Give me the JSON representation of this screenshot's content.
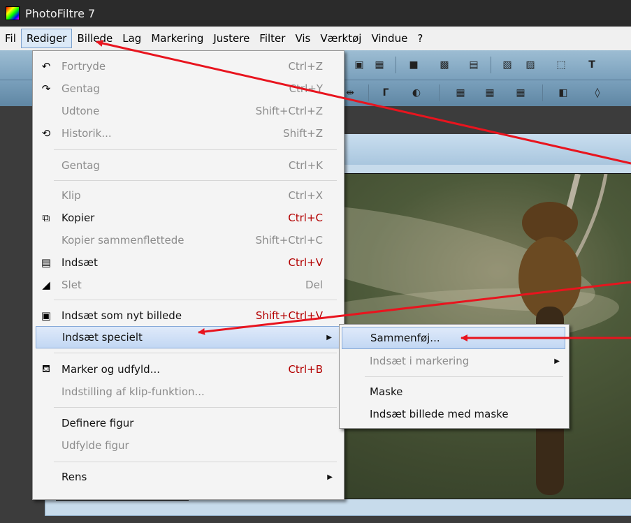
{
  "window": {
    "title": "PhotoFiltre 7"
  },
  "menubar": {
    "items": [
      {
        "label": "Fil"
      },
      {
        "label": "Rediger"
      },
      {
        "label": "Billede"
      },
      {
        "label": "Lag"
      },
      {
        "label": "Markering"
      },
      {
        "label": "Justere"
      },
      {
        "label": "Filter"
      },
      {
        "label": "Vis"
      },
      {
        "label": "Værktøj"
      },
      {
        "label": "Vindue"
      },
      {
        "label": "?"
      }
    ],
    "active": "Rediger"
  },
  "edit_menu": {
    "items": [
      {
        "label": "Fortryde",
        "shortcut": "Ctrl+Z",
        "icon": "undo-icon",
        "enabled": false
      },
      {
        "label": "Gentag",
        "shortcut": "Ctrl+Y",
        "icon": "redo-icon",
        "enabled": false
      },
      {
        "label": "Udtone",
        "shortcut": "Shift+Ctrl+Z",
        "icon": "",
        "enabled": false
      },
      {
        "label": "Historik...",
        "shortcut": "Shift+Z",
        "icon": "history-icon",
        "enabled": false
      },
      {
        "label": "Gentag",
        "shortcut": "Ctrl+K",
        "icon": "",
        "enabled": false
      },
      {
        "label": "Klip",
        "shortcut": "Ctrl+X",
        "icon": "",
        "enabled": false
      },
      {
        "label": "Kopier",
        "shortcut": "Ctrl+C",
        "icon": "copy-icon",
        "enabled": true
      },
      {
        "label": "Kopier sammenflettede",
        "shortcut": "Shift+Ctrl+C",
        "icon": "",
        "enabled": false
      },
      {
        "label": "Indsæt",
        "shortcut": "Ctrl+V",
        "icon": "paste-icon",
        "enabled": true
      },
      {
        "label": "Slet",
        "shortcut": "Del",
        "icon": "eraser-icon",
        "enabled": false
      },
      {
        "label": "Indsæt som nyt billede",
        "shortcut": "Shift+Ctrl+V",
        "icon": "paste-new-image-icon",
        "enabled": true
      },
      {
        "label": "Indsæt specielt",
        "shortcut": "",
        "icon": "",
        "enabled": true,
        "highlighted": true,
        "submenu": true
      },
      {
        "label": "Marker og udfyld...",
        "shortcut": "Ctrl+B",
        "icon": "fill-bucket-icon",
        "enabled": true
      },
      {
        "label": "Indstilling af klip-funktion...",
        "shortcut": "",
        "icon": "",
        "enabled": false
      },
      {
        "label": "Definere figur",
        "shortcut": "",
        "icon": "",
        "enabled": true
      },
      {
        "label": "Udfylde figur",
        "shortcut": "",
        "icon": "",
        "enabled": false
      },
      {
        "label": "Rens",
        "shortcut": "",
        "icon": "",
        "enabled": true,
        "submenu": true
      }
    ]
  },
  "paste_special_submenu": {
    "items": [
      {
        "label": "Sammenføj...",
        "enabled": true,
        "highlighted": true
      },
      {
        "label": "Indsæt i markering",
        "enabled": false,
        "submenu": true
      },
      {
        "label": "Maske",
        "enabled": true
      },
      {
        "label": "Indsæt billede med maske",
        "enabled": true
      }
    ]
  },
  "colors": {
    "annotation_arrow": "#e8141e",
    "highlight": "#c2d7f3",
    "shortcut_red": "#b30000"
  }
}
